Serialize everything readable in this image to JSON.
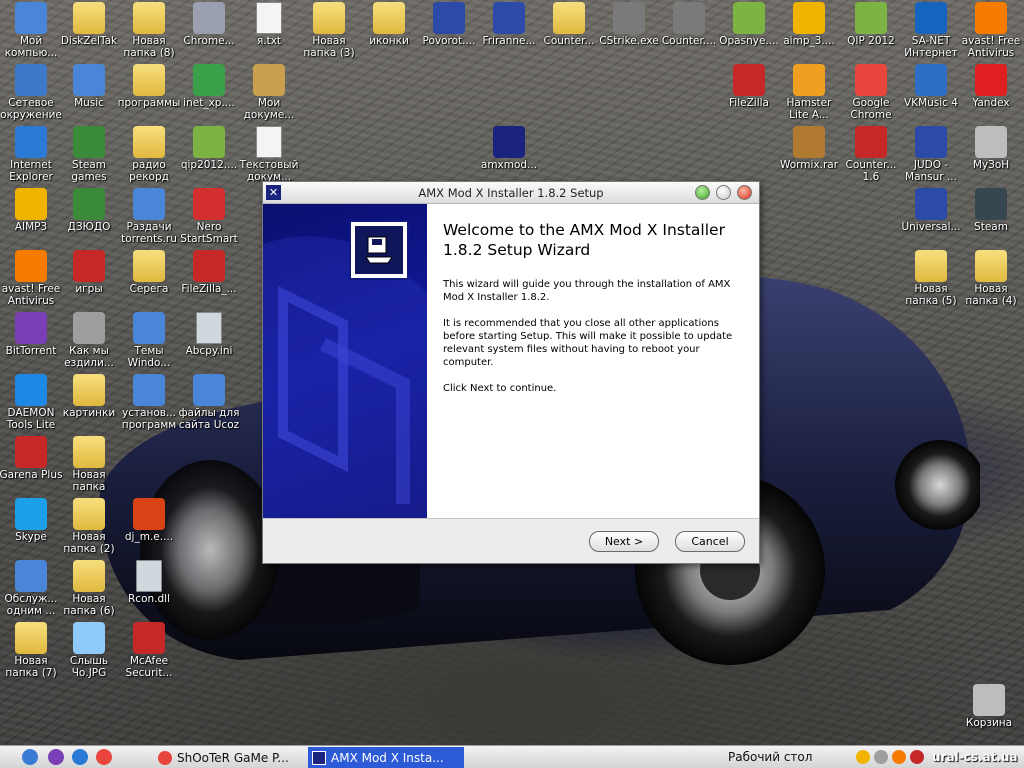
{
  "desktop": {
    "icons": [
      {
        "label": "Мой компью...",
        "icon": "my-computer-icon",
        "color": "#4a86d8"
      },
      {
        "label": "DiskZelTak",
        "icon": "folder-icon",
        "color": "#e9c65a"
      },
      {
        "label": "Новая папка (8)",
        "icon": "folder-icon",
        "color": "#e9c65a"
      },
      {
        "label": "Chrome...",
        "icon": "chrome-shortcut-icon",
        "color": "#9aa0b0"
      },
      {
        "label": "я.txt",
        "icon": "text-file-icon",
        "color": "#f4f4f4"
      },
      {
        "label": "Новая папка (3)",
        "icon": "folder-icon",
        "color": "#e9c65a"
      },
      {
        "label": "иконки",
        "icon": "folder-icon",
        "color": "#e9c65a"
      },
      {
        "label": "Povorot....",
        "icon": "avi-video-icon",
        "color": "#2c4aa8"
      },
      {
        "label": "Frirannе...",
        "icon": "avi-video-icon",
        "color": "#2c4aa8"
      },
      {
        "label": "Counter...",
        "icon": "folder-icon",
        "color": "#e9c65a"
      },
      {
        "label": "CStrike.exe",
        "icon": "counter-strike-icon",
        "color": "#7a7a7a"
      },
      {
        "label": "Counter....",
        "icon": "counter-strike-icon",
        "color": "#7a7a7a"
      },
      {
        "label": "Opasnye....",
        "icon": "mkv-video-icon",
        "color": "#7cb342"
      },
      {
        "label": "aimp_3....",
        "icon": "aimp-installer-icon",
        "color": "#f0b400"
      },
      {
        "label": "QIP 2012",
        "icon": "qip-icon",
        "color": "#7cb342"
      },
      {
        "label": "SA-NET Интернет",
        "icon": "sa-net-icon",
        "color": "#1565c0"
      },
      {
        "label": "avast! Free Antivirus",
        "icon": "avast-icon",
        "color": "#f57c00"
      },
      {
        "label": "Сетевое окружение",
        "icon": "network-icon",
        "color": "#3d78c9"
      },
      {
        "label": "Music",
        "icon": "music-folder-icon",
        "color": "#4a86d8"
      },
      {
        "label": "программы",
        "icon": "folder-icon",
        "color": "#e9c65a"
      },
      {
        "label": "inet_xp....",
        "icon": "globe-installer-icon",
        "color": "#3aa04a"
      },
      {
        "label": "Мои докуме...",
        "icon": "my-documents-icon",
        "color": "#c8a050"
      },
      {
        "label": "FileZilla",
        "icon": "filezilla-icon",
        "color": "#c62828"
      },
      {
        "label": "Hamster Lite A...",
        "icon": "hamster-archiver-icon",
        "color": "#f0a020"
      },
      {
        "label": "Google Chrome",
        "icon": "chrome-icon",
        "color": "#e8453c"
      },
      {
        "label": "VKMusic 4",
        "icon": "vkmusic-icon",
        "color": "#2c6fc4"
      },
      {
        "label": "Yandex",
        "icon": "yandex-icon",
        "color": "#e02020"
      },
      {
        "label": "Internet Explorer",
        "icon": "internet-explorer-icon",
        "color": "#2a7ad6"
      },
      {
        "label": "Steam games",
        "icon": "steam-games-icon",
        "color": "#3a8a3a"
      },
      {
        "label": "радио рекорд",
        "icon": "folder-icon",
        "color": "#e9c65a"
      },
      {
        "label": "qip2012....",
        "icon": "qip-installer-icon",
        "color": "#7cb342"
      },
      {
        "label": "Текстовый докум...",
        "icon": "text-file-icon",
        "color": "#f4f4f4"
      },
      {
        "label": "amxmod...",
        "icon": "amx-installer-icon",
        "color": "#1a237e"
      },
      {
        "label": "Wormix.rar",
        "icon": "rar-archive-icon",
        "color": "#b07a30"
      },
      {
        "label": "Counter... 1.6",
        "icon": "counter-strike-icon",
        "color": "#c62828"
      },
      {
        "label": "JUDO -Mansur ...",
        "icon": "mp4-video-icon",
        "color": "#2c4aa8"
      },
      {
        "label": "МуЗоН",
        "icon": "music-disc-icon",
        "color": "#bdbdbd"
      },
      {
        "label": "AIMP3",
        "icon": "aimp-icon",
        "color": "#f0b400"
      },
      {
        "label": "ДЗЮДО",
        "icon": "users-icon",
        "color": "#3a8a3a"
      },
      {
        "label": "Раздачи torrents.ru",
        "icon": "torrent-site-icon",
        "color": "#4a86d8"
      },
      {
        "label": "Nero StartSmart",
        "icon": "nero-icon",
        "color": "#d32f2f"
      },
      {
        "label": "Universal...",
        "icon": "avi-video-icon",
        "color": "#2c4aa8"
      },
      {
        "label": "Steam",
        "icon": "steam-icon",
        "color": "#37474f"
      },
      {
        "label": "avast! Free Antivirus",
        "icon": "avast-icon",
        "color": "#f57c00"
      },
      {
        "label": "игры",
        "icon": "games-icon",
        "color": "#c62828"
      },
      {
        "label": "Серега",
        "icon": "folder-icon",
        "color": "#e9c65a"
      },
      {
        "label": "FileZilla_...",
        "icon": "filezilla-icon",
        "color": "#c62828"
      },
      {
        "label": "Новая папка (5)",
        "icon": "folder-icon",
        "color": "#e9c65a"
      },
      {
        "label": "Новая папка (4)",
        "icon": "folder-icon",
        "color": "#e9c65a"
      },
      {
        "label": "BitTorrent",
        "icon": "bittorrent-icon",
        "color": "#7b3fb5"
      },
      {
        "label": "Как мы ездили...",
        "icon": "camera-folder-icon",
        "color": "#9e9e9e"
      },
      {
        "label": "Темы Windo...",
        "icon": "themes-icon",
        "color": "#4a86d8"
      },
      {
        "label": "Abcpy.ini",
        "icon": "config-file-icon",
        "color": "#cfd8dc"
      },
      {
        "label": "DAEMON Tools Lite",
        "icon": "daemon-tools-icon",
        "color": "#1e88e5"
      },
      {
        "label": "картинки",
        "icon": "folder-icon",
        "color": "#e9c65a"
      },
      {
        "label": "установ... программ",
        "icon": "install-programs-icon",
        "color": "#4a86d8"
      },
      {
        "label": "файлы для сайта Ucoz",
        "icon": "computer-folder-icon",
        "color": "#4a86d8"
      },
      {
        "label": "Garena Plus",
        "icon": "garena-icon",
        "color": "#c62828"
      },
      {
        "label": "Новая папка",
        "icon": "folder-icon",
        "color": "#e9c65a"
      },
      {
        "label": "Skype",
        "icon": "skype-icon",
        "color": "#1ea0e8"
      },
      {
        "label": "Новая папка (2)",
        "icon": "folder-icon",
        "color": "#e9c65a"
      },
      {
        "label": "dj_m.e....",
        "icon": "mp3-file-icon",
        "color": "#d84315"
      },
      {
        "label": "Обслуж... одним ...",
        "icon": "service-icon",
        "color": "#4a86d8"
      },
      {
        "label": "Новая папка (6)",
        "icon": "folder-icon",
        "color": "#e9c65a"
      },
      {
        "label": "Rcon.dll",
        "icon": "dll-file-icon",
        "color": "#cfd8dc"
      },
      {
        "label": "Новая папка (7)",
        "icon": "folder-icon",
        "color": "#e9c65a"
      },
      {
        "label": "Слышь Чо.JPG",
        "icon": "image-file-icon",
        "color": "#90caf9"
      },
      {
        "label": "McAfee Securit...",
        "icon": "mcafee-icon",
        "color": "#c62828"
      },
      {
        "label": "Корзина",
        "icon": "recycle-bin-icon",
        "color": "#bdbdbd"
      }
    ]
  },
  "dialog": {
    "title": "AMX Mod X Installer 1.8.2 Setup",
    "heading": "Welcome to the AMX Mod X Installer 1.8.2 Setup Wizard",
    "paragraph1": "This wizard will guide you through the installation of AMX Mod X Installer 1.8.2.",
    "paragraph2": "It is recommended that you close all other applications before starting Setup. This will make it possible to update relevant system files without having to reboot your computer.",
    "paragraph3": "Click Next to continue.",
    "next_label": "Next >",
    "cancel_label": "Cancel"
  },
  "taskbar": {
    "tasks": [
      {
        "label": "ShOoTeR GaMe P...",
        "active": false
      },
      {
        "label": "AMX Mod X Insta...",
        "active": true
      }
    ],
    "desktop_label": "Рабочий стол",
    "watermark": "ural-cs.at.ua"
  }
}
